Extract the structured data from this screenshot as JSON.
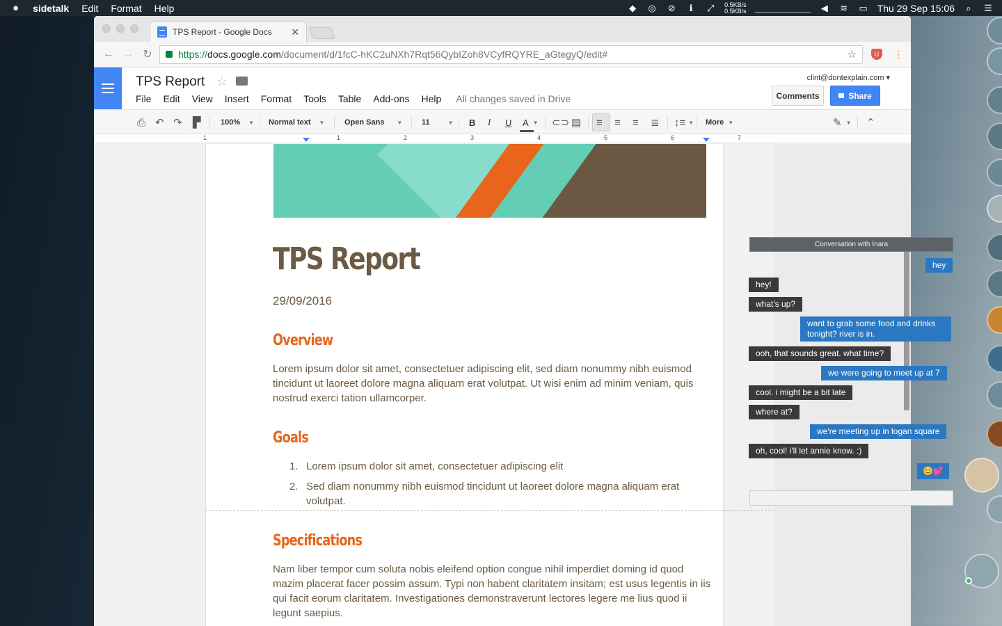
{
  "menubar": {
    "app": "sidetalk",
    "items": [
      "Edit",
      "Format",
      "Help"
    ],
    "net_up": "0.5KB/s",
    "net_down": "0.5KB/s",
    "clock": "Thu 29 Sep 15:06"
  },
  "browser": {
    "tab_title": "TPS Report - Google Docs",
    "url_scheme": "https://",
    "url_host": "docs.google.com",
    "url_path": "/document/d/1fcC-hKC2uNXh7Rqt56QybIZoh8VCyfRQYRE_aGtegyQ/edit#"
  },
  "docs": {
    "title": "TPS Report",
    "menu": [
      "File",
      "Edit",
      "View",
      "Insert",
      "Format",
      "Tools",
      "Table",
      "Add-ons",
      "Help"
    ],
    "save_status": "All changes saved in Drive",
    "account": "clint@dontexplain.com",
    "comments_label": "Comments",
    "share_label": "Share"
  },
  "toolbar": {
    "zoom": "100%",
    "style": "Normal text",
    "font": "Open Sans",
    "size": "11",
    "more": "More",
    "bold": "B",
    "italic": "I",
    "underline": "U",
    "text_color": "A"
  },
  "ruler": [
    "1",
    "1",
    "2",
    "3",
    "4",
    "5",
    "6",
    "7"
  ],
  "document": {
    "heading": "TPS Report",
    "date": "29/09/2016",
    "overview_title": "Overview",
    "overview_text": "Lorem ipsum dolor sit amet, consectetuer adipiscing elit, sed diam nonummy nibh euismod tincidunt ut laoreet dolore magna aliquam erat volutpat. Ut wisi enim ad minim veniam, quis nostrud exerci tation ullamcorper.",
    "goals_title": "Goals",
    "goals": [
      {
        "n": "1.",
        "text": "Lorem ipsum dolor sit amet, consectetuer adipiscing elit"
      },
      {
        "n": "2.",
        "text": "Sed diam nonummy nibh euismod tincidunt ut laoreet dolore magna aliquam erat volutpat."
      }
    ],
    "spec_title": "Specifications",
    "spec_text": "Nam liber tempor cum soluta nobis eleifend option congue nihil imperdiet doming id quod mazim placerat facer possim assum. Typi non habent claritatem insitam; est usus legentis in iis qui facit eorum claritatem. Investigationes demonstraverunt lectores legere me lius quod ii legunt saepius."
  },
  "chat": {
    "header": "Conversation with Inara",
    "messages": [
      {
        "from": "me",
        "text": "hey"
      },
      {
        "from": "them",
        "text": "hey!"
      },
      {
        "from": "them",
        "text": "what's up?"
      },
      {
        "from": "me",
        "text": "want to grab some food and drinks tonight? river is in."
      },
      {
        "from": "them",
        "text": "ooh, that sounds great. what time?"
      },
      {
        "from": "me",
        "text": "we were going to meet up at 7"
      },
      {
        "from": "them",
        "text": "cool. i might be a bit late"
      },
      {
        "from": "them",
        "text": "where at?"
      },
      {
        "from": "me",
        "text": "we're meeting up in logan square"
      },
      {
        "from": "them",
        "text": "oh, cool! i'll let annie know. :)"
      },
      {
        "from": "me",
        "text": "😊💕"
      }
    ]
  },
  "colors": {
    "brand_blue": "#4285f4",
    "heading_brown": "#6b5a44",
    "accent_orange": "#e8661b",
    "chat_out": "#2b78c2",
    "chat_in": "#3a3a3a"
  }
}
